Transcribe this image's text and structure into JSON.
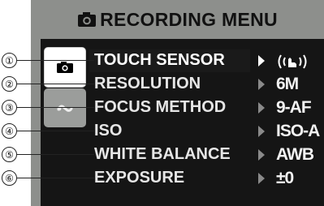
{
  "menu": {
    "title": "RECORDING MENU",
    "title_icon": "camera-icon",
    "tabs": [
      {
        "name": "camera-tab",
        "icon": "camera-icon",
        "selected": true
      },
      {
        "name": "setup-tab",
        "icon": "wrench-icon",
        "selected": false
      }
    ],
    "items": [
      {
        "callout": "①",
        "label": "TOUCH SENSOR",
        "value": "((ⱃ))",
        "selected": true
      },
      {
        "callout": "②",
        "label": "RESOLUTION",
        "value": "6M",
        "selected": false
      },
      {
        "callout": "③",
        "label": "FOCUS METHOD",
        "value": "9-AF",
        "selected": false
      },
      {
        "callout": "④",
        "label": "ISO",
        "value": "ISO-A",
        "selected": false
      },
      {
        "callout": "⑤",
        "label": "WHITE BALANCE",
        "value": "AWB",
        "selected": false
      },
      {
        "callout": "⑥",
        "label": "EXPOSURE",
        "value": "±0",
        "selected": false
      }
    ]
  },
  "colors": {
    "frame": "#8d8f8c",
    "panel": "#151515",
    "selected_tab": "#ffffff"
  }
}
